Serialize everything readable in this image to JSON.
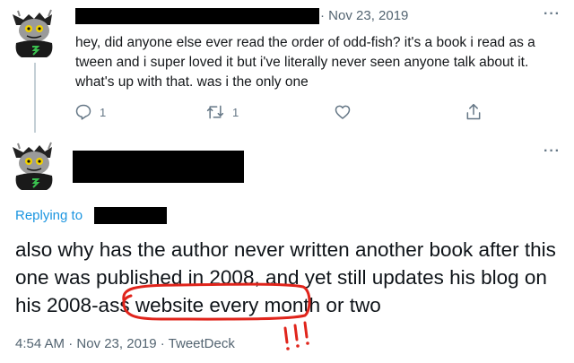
{
  "tweet1": {
    "date": "· Nov 23, 2019",
    "more": "···",
    "text": "hey, did anyone else ever read the order of odd-fish? it's a book i read as a tween and i super loved it but i've literally never seen anyone talk about it. what's up with that. was i the only one",
    "actions": {
      "reply_icon": "reply-icon",
      "reply_count": "1",
      "retweet_icon": "retweet-icon",
      "retweet_count": "1",
      "like_icon": "heart-icon",
      "share_icon": "share-icon"
    }
  },
  "tweet2": {
    "more": "···",
    "replying_label": "Replying to",
    "text_before": "also why has the author never written another book after this one was published in 2008, and yet still updates his blog on his ",
    "text_circled": "2008-ass website",
    "text_after": " every month or two",
    "meta": "4:54 AM · Nov 23, 2019 · TweetDeck",
    "annotation_text": "!!!"
  },
  "colors": {
    "secondary_text": "#536471",
    "link_blue": "#1b95e0",
    "annotation_red": "#e0241b",
    "redaction": "#000000"
  }
}
